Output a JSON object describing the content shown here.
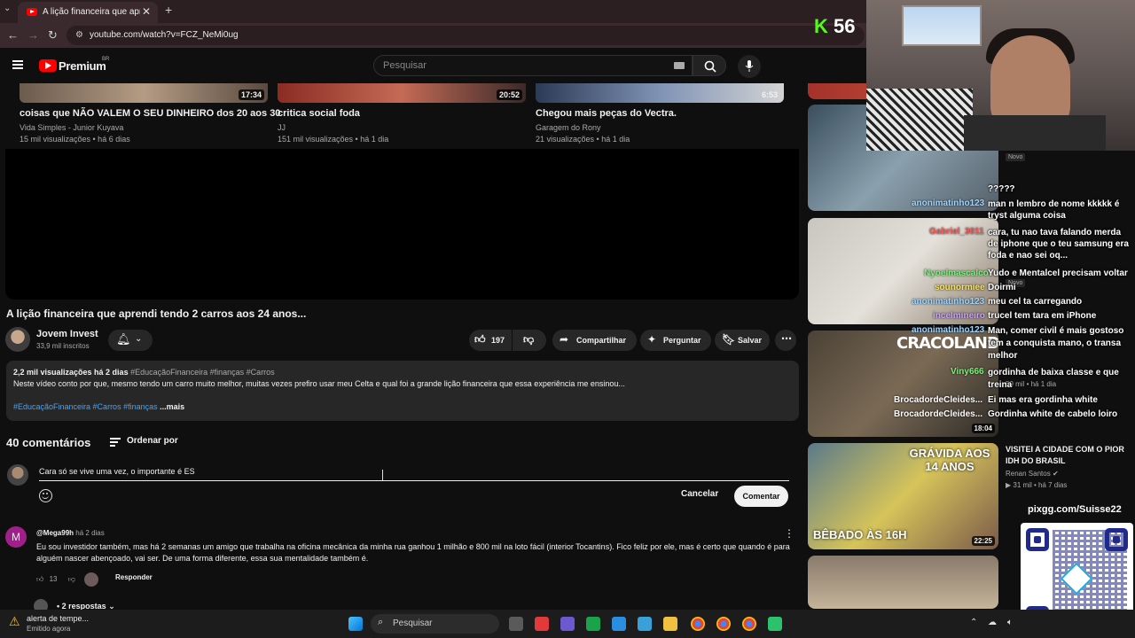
{
  "browser": {
    "tab_title": "A lição financeira que aprendi t",
    "url": "youtube.com/watch?v=FCZ_NeMi0ug"
  },
  "header": {
    "logo_text": "Premium",
    "logo_region": "BR",
    "search_placeholder": "Pesquisar"
  },
  "related": [
    {
      "title": "coisas que NÃO VALEM O SEU DINHEIRO dos 20 aos 30",
      "channel": "Vida Simples - Junior Kuyava",
      "meta": "15 mil visualizações • há 6 dias",
      "duration": "17:34"
    },
    {
      "title": "critica social foda",
      "channel": "JJ",
      "meta": "151 mil visualizações • há 1 dia",
      "duration": "20:52"
    },
    {
      "title": "Chegou mais peças do Vectra.",
      "channel": "Garagem do Rony",
      "meta": "21 visualizações • há 1 dia",
      "duration": "6:53"
    }
  ],
  "video": {
    "title": "A lição financeira que aprendi tendo 2 carros aos 24 anos...",
    "channel": "Jovem Invest",
    "subscribers": "33,9 mil inscritos",
    "likes": "197",
    "share": "Compartilhar",
    "ask": "Perguntar",
    "save": "Salvar"
  },
  "description": {
    "stats": "2,2 mil visualizações  há 2 dias",
    "hashtags_top": "#EducaçãoFinanceira #finanças #Carros",
    "text": "Neste vídeo conto por que, mesmo tendo um carro muito melhor, muitas vezes prefiro usar meu Celta e qual foi a grande lição financeira que essa experiência me ensinou...",
    "hashtags_bottom": "#EducaçãoFinanceira #Carros #finanças",
    "more": " ...mais"
  },
  "comments": {
    "count_label": "40 comentários",
    "sort_label": "Ordenar por",
    "draft": "Cara só se vive uma vez, o importante é ES",
    "cancel": "Cancelar",
    "submit": "Comentar",
    "items": [
      {
        "avatar_letter": "M",
        "author": "@Mega99h",
        "time": "há 2 dias",
        "text": "Eu sou investidor também, mas há 2 semanas um amigo que trabalha na oficina mecânica da minha rua ganhou 1 milhão e 800 mil na loto fácil (interior Tocantins). Fico feliz por ele, mas é certo que quando é para alguém nascer abençoado, vai ser. De uma forma diferente, essa sua mentalidade também é.",
        "likes": "13",
        "reply": "Responder",
        "replies": "2 respostas"
      }
    ]
  },
  "sidebar": [
    {
      "badge": "Novo",
      "duration": ""
    },
    {
      "badge": "Novo",
      "duration": ""
    },
    {
      "title": "",
      "channel": "",
      "meta": "59 mil • há 1 dia",
      "duration": "18:04"
    },
    {
      "title": "VISITEI A CIDADE COM O PIOR IDH DO BRASIL",
      "channel": "Renan Santos",
      "meta": "31 mil • há 7 dias",
      "duration": "22:25"
    }
  ],
  "thumb_text": {
    "cracolandia": "CRACOLANDIA",
    "gravida": "GRÁVIDA AOS 14 ANOS",
    "bebado": "BÊBADO ÀS 16H"
  },
  "stream": {
    "viewer_count": "56",
    "pix_url": "pixgg.com/Suisse22"
  },
  "chat": [
    {
      "user": "",
      "msg": "?????"
    },
    {
      "user": "anonimatinho123",
      "msg": "man n lembro de nome kkkkk é tryst alguma coisa"
    },
    {
      "user": "Gabriel_3011",
      "msg": "cara, tu nao tava falando merda de iphone que o teu samsung era foda e nao sei oq..."
    },
    {
      "user": "Nyoelmascalco",
      "msg": "Yudo e Mentalcel precisam voltar"
    },
    {
      "user": "sounormiee",
      "msg": "Doirmi"
    },
    {
      "user": "anonimatinho123",
      "msg": "meu cel ta carregando"
    },
    {
      "user": "incelmineiro",
      "msg": "trucel tem tara em iPhone"
    },
    {
      "user": "anonimatinho123",
      "msg": "Man, comer civil é mais gostoso tem a conquista mano, o transa melhor"
    },
    {
      "user": "Viny666",
      "msg": "gordinha de baixa classe e que treina"
    },
    {
      "user": "BrocadordeCleides...",
      "msg": "Ei mas era gordinha white"
    },
    {
      "user": "BrocadordeCleides...",
      "msg": "Gordinha white de cabelo loiro"
    }
  ],
  "taskbar": {
    "notif_title": "alerta de tempe...",
    "notif_sub": "Emitido agora",
    "search_placeholder": "Pesquisar"
  },
  "colors": {
    "youtube_red": "#ff0000",
    "kick_green": "#53fc18",
    "link_blue": "#3ea6ff"
  }
}
